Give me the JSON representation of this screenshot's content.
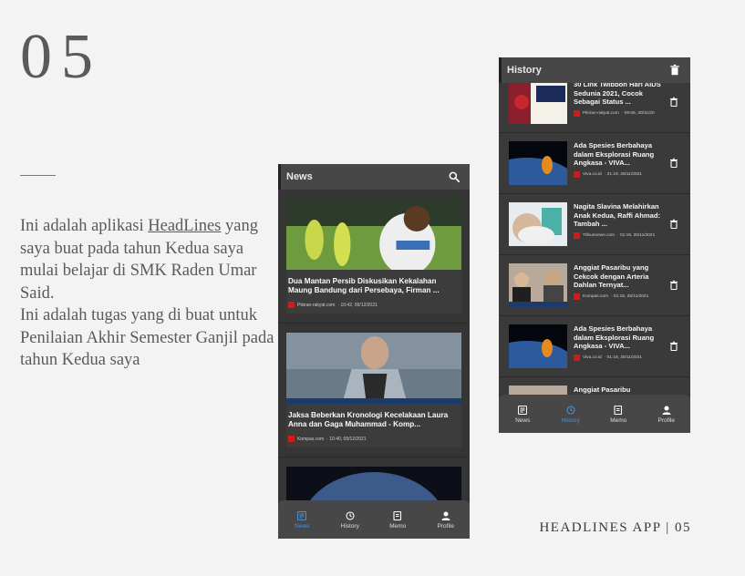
{
  "slide": {
    "number": "05",
    "description_line_1": "Ini adalah aplikasi ",
    "description_link": "HeadLines",
    "description_line_2": " yang saya buat pada tahun Kedua saya mulai belajar di SMK Raden Umar Said.",
    "description_line_3": "Ini adalah tugas yang di buat untuk Penilaian Akhir Semester Ganjil pada tahun Kedua saya",
    "footer": "HEADLINES APP | 05"
  },
  "news_screen": {
    "title": "News",
    "items": [
      {
        "title": "Dua Mantan Persib Diskusikan Kekalahan Maung Bandung dari Persebaya, Firman ...",
        "source": "Pikiran-rakyat.com",
        "time": "· 10:42, 09/12/2021",
        "image": "soccer-photo"
      },
      {
        "title": "Jaksa Beberkan Kronologi Kecelakaan Laura Anna dan Gaga Muhammad - Komp...",
        "source": "Kompas.com",
        "time": "· 10:40, 09/12/2021",
        "image": "man-photo"
      },
      {
        "title": "",
        "source": "",
        "time": "",
        "image": "earth-photo"
      }
    ],
    "nav": [
      {
        "label": "News",
        "icon": "news-icon",
        "active": true
      },
      {
        "label": "History",
        "icon": "history-icon",
        "active": false
      },
      {
        "label": "Memo",
        "icon": "memo-icon",
        "active": false
      },
      {
        "label": "Profile",
        "icon": "profile-icon",
        "active": false
      }
    ]
  },
  "history_screen": {
    "title": "History",
    "items": [
      {
        "title": "30 Link Twibbon Hari AIDS Sedunia 2021, Cocok Sebagai Status ...",
        "source": "Pikiran-rakyat.com",
        "time": "· 09:06, 30/11/20",
        "image": "aids-photo"
      },
      {
        "title": "Ada Spesies Berbahaya dalam Eksplorasi Ruang Angkasa - VIVA...",
        "source": "Viva.co.id",
        "time": "· 21:19, 26/11/2021",
        "image": "space-photo"
      },
      {
        "title": "Nagita Slavina Melahirkan Anak Kedua, Raffi Ahmad: Tambah ...",
        "source": "Tribunnews.com",
        "time": "· 01:19, 26/11/2021",
        "image": "hospital-photo"
      },
      {
        "title": "Anggiat Pasaribu yang Cekcok dengan Arteria Dahlan Ternyat...",
        "source": "Kompas.com",
        "time": "· 01:18, 26/11/2021",
        "image": "people-photo"
      },
      {
        "title": "Ada Spesies Berbahaya dalam Eksplorasi Ruang Angkasa - VIVA...",
        "source": "Viva.co.id",
        "time": "· 01:18, 26/11/2021",
        "image": "space-photo"
      },
      {
        "title": "Anggiat Pasaribu",
        "source": "",
        "time": "",
        "image": "people-photo"
      }
    ],
    "nav": [
      {
        "label": "News",
        "icon": "news-icon",
        "active": false
      },
      {
        "label": "History",
        "icon": "history-icon",
        "active": true
      },
      {
        "label": "Memo",
        "icon": "memo-icon",
        "active": false
      },
      {
        "label": "Profile",
        "icon": "profile-icon",
        "active": false
      }
    ]
  },
  "colors": {
    "background": "#f3f3f3",
    "phone_bg": "#353535",
    "appbar": "#474747",
    "accent": "#4a90d9",
    "favicon": "#d21a1a"
  }
}
